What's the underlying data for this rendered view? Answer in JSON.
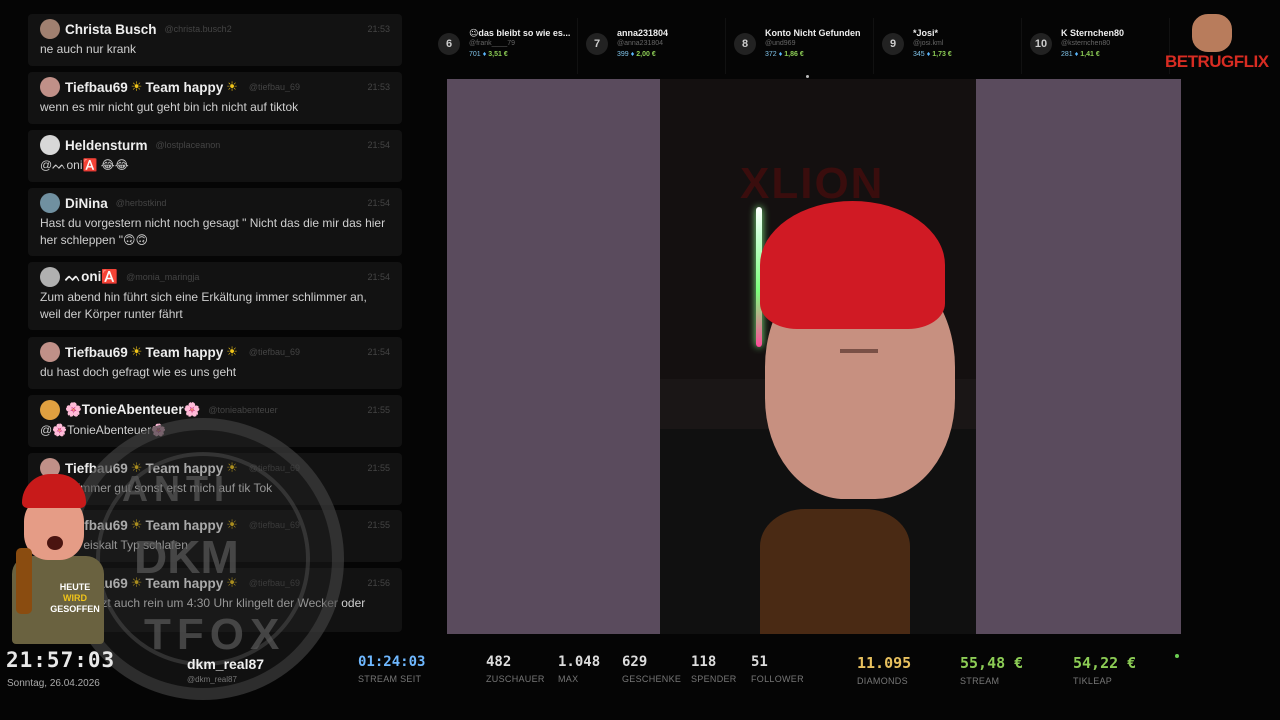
{
  "chat": {
    "messages": [
      {
        "name": "Christa Busch",
        "team": "",
        "badges": false,
        "handle": "@christa.busch2",
        "time": "21:53",
        "text": "ne auch nur krank",
        "avatar_color": "#a08070"
      },
      {
        "name": "Tiefbau69",
        "team": "Team happy",
        "badges": true,
        "handle": "@tiefbau_69",
        "time": "21:53",
        "text": "wenn es mir nicht gut geht bin ich nicht auf tiktok",
        "avatar_color": "#c09088"
      },
      {
        "name": "Heldensturm",
        "team": "",
        "badges": false,
        "handle": "@lostplaceanon",
        "time": "21:54",
        "text": "@ᨓoni🅰️ 😂😂",
        "avatar_color": "#d8d8d8"
      },
      {
        "name": "DiNina",
        "team": "",
        "badges": false,
        "handle": "@herbstkind",
        "time": "21:54",
        "text": "Hast du vorgestern nicht noch gesagt \" Nicht das die mir das hier her schleppen \"🙃🙃",
        "avatar_color": "#7090a0"
      },
      {
        "name": "ᨓoni🅰️",
        "team": "",
        "badges": false,
        "handle": "@monia_maringja",
        "time": "21:54",
        "text": "Zum abend hin führt sich eine Erkältung immer schlimmer an, weil der Körper runter fährt",
        "avatar_color": "#b0b0b0"
      },
      {
        "name": "Tiefbau69",
        "team": "Team happy",
        "badges": true,
        "handle": "@tiefbau_69",
        "time": "21:54",
        "text": "du hast doch gefragt wie es uns geht",
        "avatar_color": "#c09088"
      },
      {
        "name": "🌸TonieAbenteuer🌸",
        "team": "",
        "badges": false,
        "handle": "@tonieabenteuer",
        "time": "21:55",
        "text": "@🌸TonieAbenteuer🌸",
        "avatar_color": "#e0a040"
      },
      {
        "name": "Tiefbau69",
        "team": "Team happy",
        "badges": true,
        "handle": "@tiefbau_69",
        "time": "21:55",
        "text": "Geht's immer gut sonst erst mich auf tik Tok",
        "avatar_color": "#c09088"
      },
      {
        "name": "Tiefbau69",
        "team": "Team happy",
        "badges": true,
        "handle": "@tiefbau_69",
        "time": "21:55",
        "text": "Einfach eiskalt Typ schlafen",
        "avatar_color": "#c09088"
      },
      {
        "name": "Tiefbau69",
        "team": "Team happy",
        "badges": true,
        "handle": "@tiefbau_69",
        "time": "21:56",
        "text": "ich gehe jetzt auch rein um 4:30 Uhr klingelt der Wecker oder",
        "avatar_color": "#c09088"
      }
    ]
  },
  "overlay": {
    "medallion_top": "ANTI",
    "medallion_mid": "DKM",
    "medallion_bot": "TFOX",
    "mascot_slogan_1": "HEUTE",
    "mascot_slogan_2": "WIRD",
    "mascot_slogan_3": "GESOFFEN"
  },
  "leaderboard": [
    {
      "rank": "6",
      "name": "😉das bleibt so wie es...",
      "handle": "@frank____79",
      "count": "701",
      "money": "3,51 €"
    },
    {
      "rank": "7",
      "name": "anna231804",
      "handle": "@anna231804",
      "count": "399",
      "money": "2,00 €"
    },
    {
      "rank": "8",
      "name": "Konto Nicht Gefunden",
      "handle": "@und969",
      "count": "372",
      "money": "1,86 €"
    },
    {
      "rank": "9",
      "name": "*Josi*",
      "handle": "@josi.kml",
      "count": "345",
      "money": "1,73 €"
    },
    {
      "rank": "10",
      "name": "K Sternchen80",
      "handle": "@ksternchen80",
      "count": "281",
      "money": "1,41 €"
    }
  ],
  "logo": {
    "text": "BETRUGFLIX"
  },
  "video": {
    "bg_text": "XLION"
  },
  "footer": {
    "clock": "21:57:03",
    "date": "Sonntag, 26.04.2026",
    "streamer_name": "dkm_real87",
    "streamer_handle": "@dkm_real87",
    "stats": [
      {
        "id": "time",
        "value": "01:24:03",
        "label": "STREAM SEIT"
      },
      {
        "id": "viewers",
        "value": "482",
        "label": "ZUSCHAUER"
      },
      {
        "id": "max",
        "value": "1.048",
        "label": "MAX"
      },
      {
        "id": "gifts",
        "value": "629",
        "label": "GESCHENKE"
      },
      {
        "id": "donors",
        "value": "118",
        "label": "SPENDER"
      },
      {
        "id": "followers",
        "value": "51",
        "label": "FOLLOWER"
      },
      {
        "id": "diamonds",
        "value": "11.095",
        "label": "DIAMONDS"
      },
      {
        "id": "stream",
        "value": "55,48 €",
        "label": "STREAM"
      },
      {
        "id": "tikleap",
        "value": "54,22 €",
        "label": "TIKLEAP"
      }
    ]
  },
  "colors": {
    "accent_blue": "#6fb8ff",
    "accent_green": "#8ccc55",
    "accent_gold": "#e8c15f",
    "video_bg": "#5a4b5d"
  }
}
